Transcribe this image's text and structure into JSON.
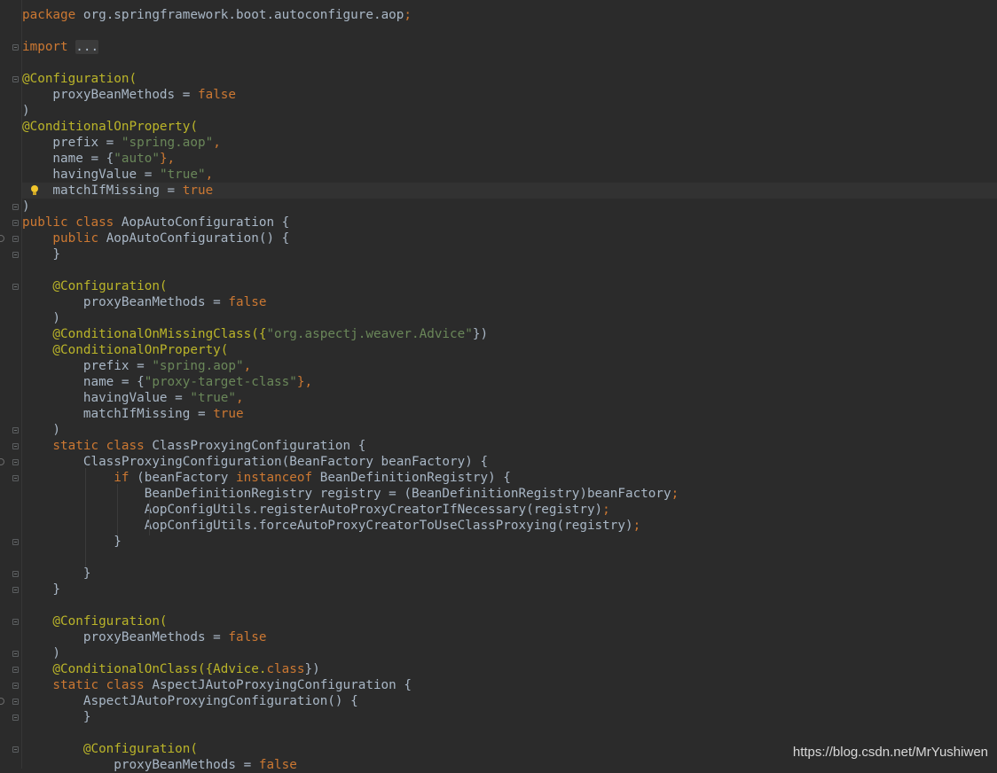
{
  "editor": {
    "language": "java",
    "caret_line_index": 11,
    "lines": [
      [
        {
          "t": "package ",
          "c": "kw"
        },
        {
          "t": "org.springframework.boot.autoconfigure.aop",
          "c": ""
        },
        {
          "t": ";",
          "c": "punc"
        }
      ],
      [],
      [
        {
          "t": "import ",
          "c": "kw"
        },
        {
          "t": "...",
          "c": "fold"
        }
      ],
      [],
      [
        {
          "t": "@Configuration(",
          "c": "ann"
        }
      ],
      [
        {
          "t": "    proxyBeanMethods = ",
          "c": ""
        },
        {
          "t": "false",
          "c": "kw"
        }
      ],
      [
        {
          "t": ")",
          "c": ""
        }
      ],
      [
        {
          "t": "@ConditionalOnProperty(",
          "c": "ann"
        }
      ],
      [
        {
          "t": "    prefix = ",
          "c": ""
        },
        {
          "t": "\"spring.aop\"",
          "c": "str"
        },
        {
          "t": ",",
          "c": "punc"
        }
      ],
      [
        {
          "t": "    name = {",
          "c": ""
        },
        {
          "t": "\"auto\"",
          "c": "str"
        },
        {
          "t": "},",
          "c": "punc"
        }
      ],
      [
        {
          "t": "    havingValue = ",
          "c": ""
        },
        {
          "t": "\"true\"",
          "c": "str"
        },
        {
          "t": ",",
          "c": "punc"
        }
      ],
      [
        {
          "t": "    matchIfMissing = ",
          "c": ""
        },
        {
          "t": "true",
          "c": "kw"
        }
      ],
      [
        {
          "t": ")",
          "c": ""
        }
      ],
      [
        {
          "t": "public class ",
          "c": "kw"
        },
        {
          "t": "AopAutoConfiguration {",
          "c": ""
        }
      ],
      [
        {
          "t": "    public ",
          "c": "kw"
        },
        {
          "t": "AopAutoConfiguration() {",
          "c": ""
        }
      ],
      [
        {
          "t": "    }",
          "c": ""
        }
      ],
      [],
      [
        {
          "t": "    @Configuration(",
          "c": "ann"
        }
      ],
      [
        {
          "t": "        proxyBeanMethods = ",
          "c": ""
        },
        {
          "t": "false",
          "c": "kw"
        }
      ],
      [
        {
          "t": "    )",
          "c": ""
        }
      ],
      [
        {
          "t": "    @ConditionalOnMissingClass({",
          "c": "ann"
        },
        {
          "t": "\"org.aspectj.weaver.Advice\"",
          "c": "str"
        },
        {
          "t": "})",
          "c": ""
        }
      ],
      [
        {
          "t": "    @ConditionalOnProperty(",
          "c": "ann"
        }
      ],
      [
        {
          "t": "        prefix = ",
          "c": ""
        },
        {
          "t": "\"spring.aop\"",
          "c": "str"
        },
        {
          "t": ",",
          "c": "punc"
        }
      ],
      [
        {
          "t": "        name = {",
          "c": ""
        },
        {
          "t": "\"proxy-target-class\"",
          "c": "str"
        },
        {
          "t": "},",
          "c": "punc"
        }
      ],
      [
        {
          "t": "        havingValue = ",
          "c": ""
        },
        {
          "t": "\"true\"",
          "c": "str"
        },
        {
          "t": ",",
          "c": "punc"
        }
      ],
      [
        {
          "t": "        matchIfMissing = ",
          "c": ""
        },
        {
          "t": "true",
          "c": "kw"
        }
      ],
      [
        {
          "t": "    )",
          "c": ""
        }
      ],
      [
        {
          "t": "    static class ",
          "c": "kw"
        },
        {
          "t": "ClassProxyingConfiguration {",
          "c": ""
        }
      ],
      [
        {
          "t": "        ClassProxyingConfiguration(BeanFactory beanFactory) {",
          "c": ""
        }
      ],
      [
        {
          "t": "            if ",
          "c": "kw"
        },
        {
          "t": "(beanFactory ",
          "c": ""
        },
        {
          "t": "instanceof ",
          "c": "kw"
        },
        {
          "t": "BeanDefinitionRegistry) {",
          "c": ""
        }
      ],
      [
        {
          "t": "                BeanDefinitionRegistry registry = (BeanDefinitionRegistry)beanFactory",
          "c": ""
        },
        {
          "t": ";",
          "c": "punc"
        }
      ],
      [
        {
          "t": "                AopConfigUtils.registerAutoProxyCreatorIfNecessary(registry)",
          "c": ""
        },
        {
          "t": ";",
          "c": "punc"
        }
      ],
      [
        {
          "t": "                AopConfigUtils.forceAutoProxyCreatorToUseClassProxying(registry)",
          "c": ""
        },
        {
          "t": ";",
          "c": "punc"
        }
      ],
      [
        {
          "t": "            }",
          "c": ""
        }
      ],
      [],
      [
        {
          "t": "        }",
          "c": ""
        }
      ],
      [
        {
          "t": "    }",
          "c": ""
        }
      ],
      [],
      [
        {
          "t": "    @Configuration(",
          "c": "ann"
        }
      ],
      [
        {
          "t": "        proxyBeanMethods = ",
          "c": ""
        },
        {
          "t": "false",
          "c": "kw"
        }
      ],
      [
        {
          "t": "    )",
          "c": ""
        }
      ],
      [
        {
          "t": "    @ConditionalOnClass({Advice.",
          "c": "ann"
        },
        {
          "t": "class",
          "c": "kw"
        },
        {
          "t": "})",
          "c": ""
        }
      ],
      [
        {
          "t": "    static class ",
          "c": "kw"
        },
        {
          "t": "AspectJAutoProxyingConfiguration {",
          "c": ""
        }
      ],
      [
        {
          "t": "        AspectJAutoProxyingConfiguration() {",
          "c": ""
        }
      ],
      [
        {
          "t": "        }",
          "c": ""
        }
      ],
      [],
      [
        {
          "t": "        @Configuration(",
          "c": "ann"
        }
      ],
      [
        {
          "t": "            proxyBeanMethods = ",
          "c": ""
        },
        {
          "t": "false",
          "c": "kw"
        }
      ]
    ],
    "fold_marker_lines": [
      2,
      4,
      12,
      13,
      14,
      15,
      17,
      26,
      27,
      28,
      29,
      33,
      35,
      36,
      38,
      40,
      41,
      42,
      43,
      44,
      46
    ],
    "override_marker_lines": [
      14,
      28,
      43
    ],
    "bulb_line": 11,
    "bulb_icon": "lightbulb-icon"
  },
  "colors": {
    "background": "#2b2b2b",
    "keyword": "#cc7832",
    "annotation": "#bbb529",
    "string": "#6a8759",
    "text": "#a9b7c6"
  },
  "watermark": "https://blog.csdn.net/MrYushiwen"
}
